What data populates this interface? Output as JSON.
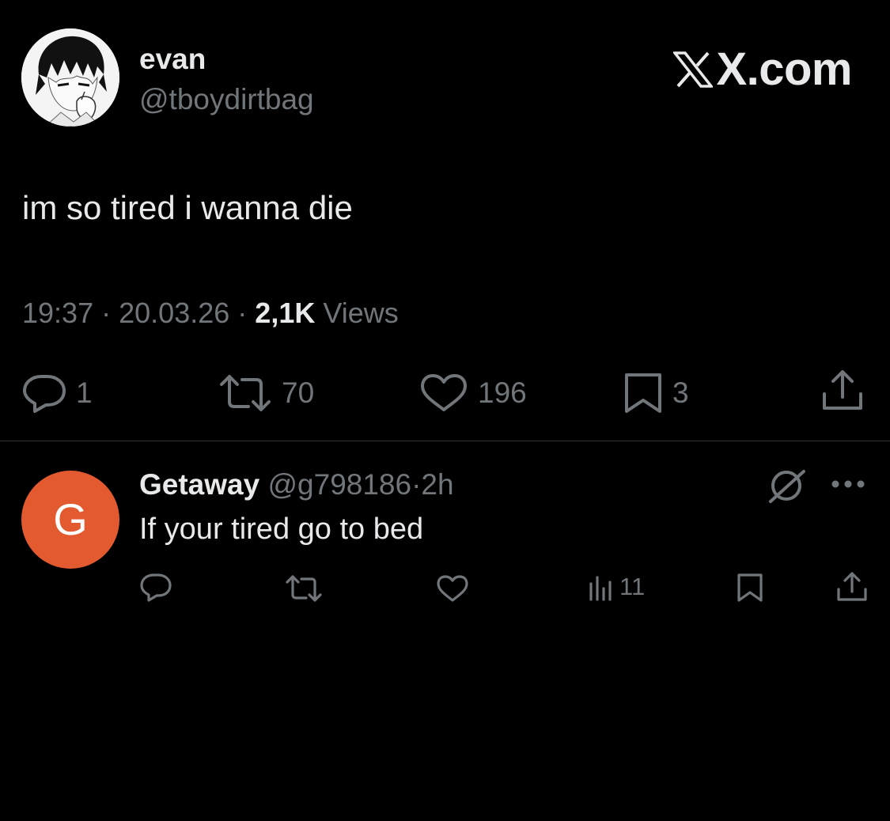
{
  "tweet": {
    "display_name": "evan",
    "handle": "@tboydirtbag",
    "brand": "X.com",
    "text": "im so tired i wanna die",
    "time": "19:37",
    "date": "20.03.26",
    "separator": "·",
    "views_count": "2,1K",
    "views_label": "Views",
    "actions": {
      "replies": "1",
      "reposts": "70",
      "likes": "196",
      "bookmarks": "3"
    }
  },
  "reply": {
    "avatar_letter": "G",
    "avatar_color": "#e35a30",
    "display_name": "Getaway",
    "handle": "@g798186",
    "separator": "·",
    "age": "2h",
    "text": "If your tired go to bed",
    "views": "11"
  },
  "icons": {
    "reply": "speech-bubble-icon",
    "repost": "repost-arrows-icon",
    "like": "heart-icon",
    "bookmark": "bookmark-icon",
    "share": "share-upload-icon",
    "views": "bar-chart-icon",
    "grok": "grok-slash-circle-icon",
    "more": "more-dots-icon"
  },
  "colors": {
    "background": "#000000",
    "primary_text": "#e7e9ea",
    "secondary_text": "#71767b",
    "divider": "#2f3336"
  }
}
